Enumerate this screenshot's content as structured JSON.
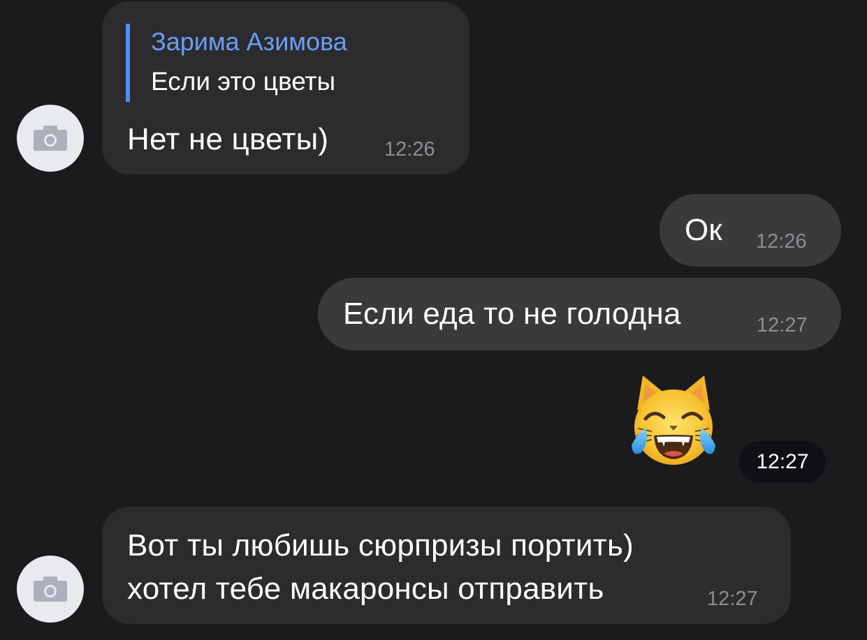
{
  "messages": [
    {
      "reply": {
        "author": "Зарима Азимова",
        "text": "Если это цветы"
      },
      "text": "Нет не цветы)",
      "time": "12:26"
    },
    {
      "text": "Ок",
      "time": "12:26"
    },
    {
      "text": "Если еда то не голодна",
      "time": "12:27"
    },
    {
      "emoji": "cat-tears-of-joy",
      "time": "12:27"
    },
    {
      "text_line1": "Вот ты любишь сюрпризы портить)",
      "text_line2": "хотел тебе макаронсы отправить",
      "time": "12:27"
    }
  ],
  "colors": {
    "background": "#1b1b1d",
    "incoming_bubble": "#2c2c2e",
    "outgoing_bubble": "#3a3a3c",
    "reply_accent": "#4f8ef7",
    "time_text": "#8e8e93"
  }
}
